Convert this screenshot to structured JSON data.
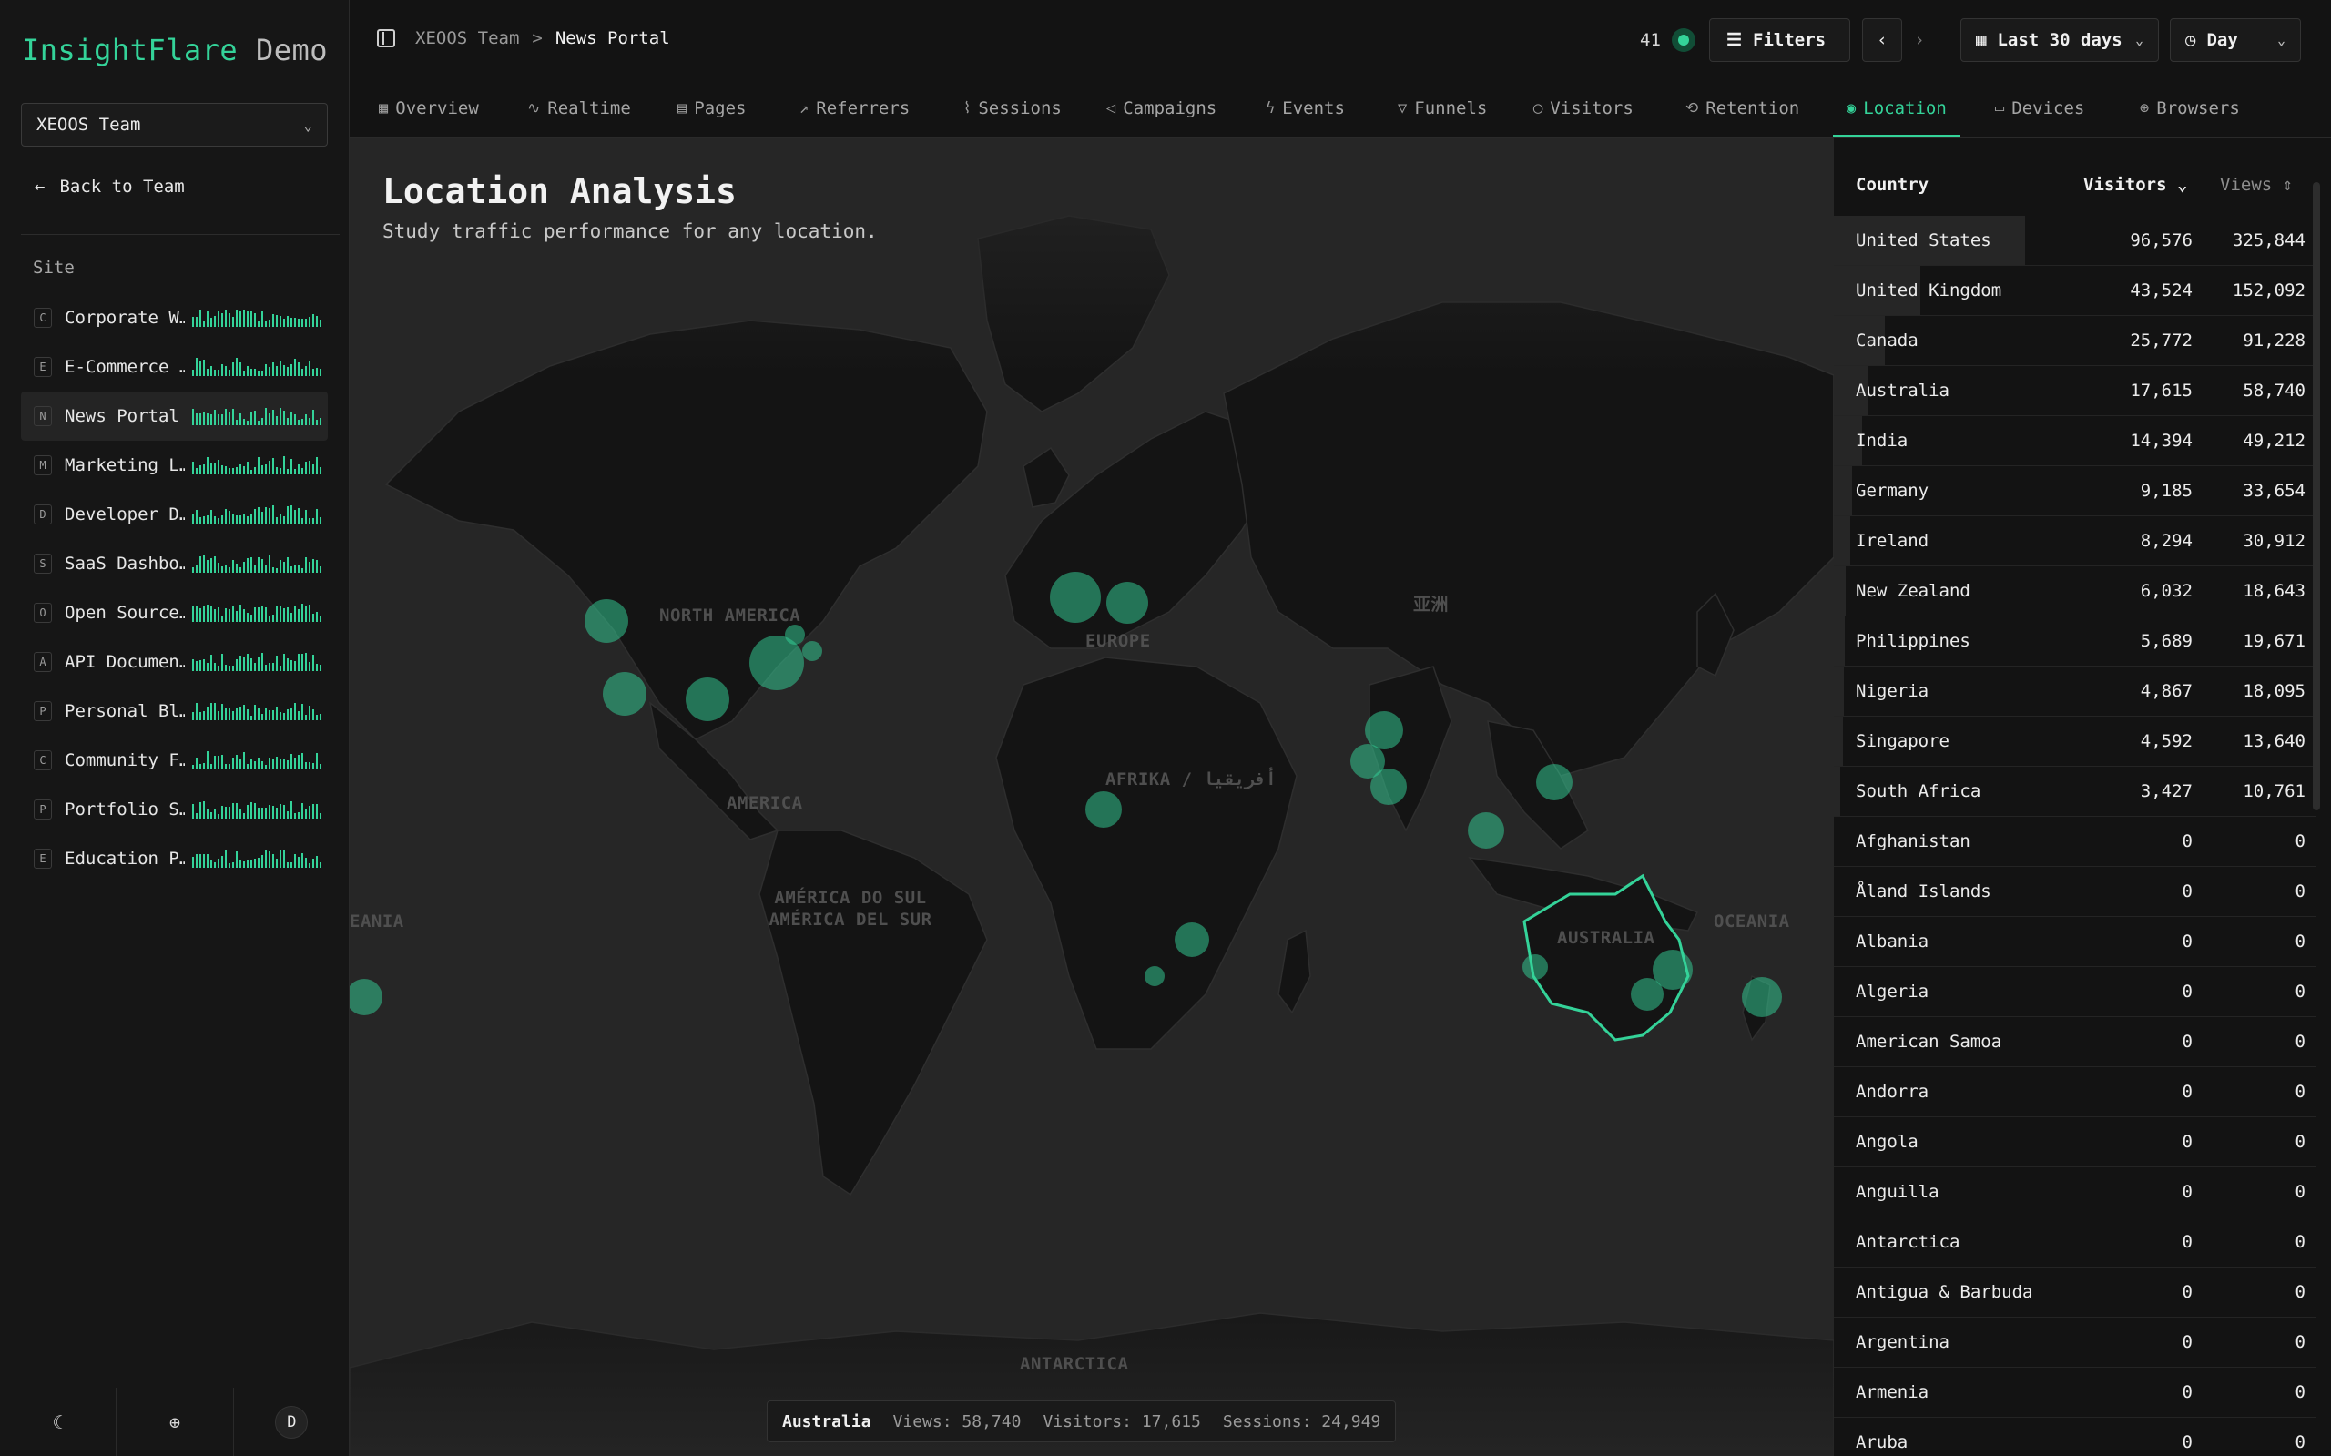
{
  "brand": {
    "name": "InsightFlare",
    "suffix": "Demo"
  },
  "team_select": {
    "value": "XEOOS Team"
  },
  "back_label": "Back to Team",
  "site_section_label": "Site",
  "sites": [
    {
      "badge": "C",
      "name": "Corporate W…"
    },
    {
      "badge": "E",
      "name": "E-Commerce …"
    },
    {
      "badge": "N",
      "name": "News Portal"
    },
    {
      "badge": "M",
      "name": "Marketing L…"
    },
    {
      "badge": "D",
      "name": "Developer D…"
    },
    {
      "badge": "S",
      "name": "SaaS Dashbo…"
    },
    {
      "badge": "O",
      "name": "Open Source…"
    },
    {
      "badge": "A",
      "name": "API Documen…"
    },
    {
      "badge": "P",
      "name": "Personal Bl…"
    },
    {
      "badge": "C",
      "name": "Community F…"
    },
    {
      "badge": "P",
      "name": "Portfolio S…"
    },
    {
      "badge": "E",
      "name": "Education P…"
    }
  ],
  "active_site_index": 2,
  "footer": {
    "avatar_initial": "D"
  },
  "breadcrumb": {
    "team": "XEOOS Team",
    "separator": ">",
    "site": "News Portal"
  },
  "live_count": "41",
  "toolbar": {
    "filters_label": "Filters",
    "range_label": "Last 30 days",
    "granularity_label": "Day"
  },
  "tabs": [
    {
      "label": "Overview",
      "icon": "grid-icon"
    },
    {
      "label": "Realtime",
      "icon": "pulse-icon"
    },
    {
      "label": "Pages",
      "icon": "page-icon"
    },
    {
      "label": "Referrers",
      "icon": "referrer-icon"
    },
    {
      "label": "Sessions",
      "icon": "activity-icon"
    },
    {
      "label": "Campaigns",
      "icon": "megaphone-icon"
    },
    {
      "label": "Events",
      "icon": "bolt-icon"
    },
    {
      "label": "Funnels",
      "icon": "funnel-icon"
    },
    {
      "label": "Visitors",
      "icon": "user-icon"
    },
    {
      "label": "Retention",
      "icon": "repeat-icon"
    },
    {
      "label": "Location",
      "icon": "pin-icon"
    },
    {
      "label": "Devices",
      "icon": "monitor-icon"
    },
    {
      "label": "Browsers",
      "icon": "globe-icon"
    }
  ],
  "active_tab": "Location",
  "page": {
    "title": "Location Analysis",
    "subtitle": "Study traffic performance for any location."
  },
  "map_labels": [
    "NORTH AMERICA",
    "EUROPE",
    "亚洲",
    "AFRIKA / أفريقيا",
    "AMERICA",
    "AMÉRICA DO SUL AMÉRICA DEL SUR",
    "AUSTRALIA",
    "OCEANIA",
    "EANIA",
    "ANTARCTICA"
  ],
  "map_colors": {
    "bubble": "#34d399",
    "highlight": "#34d399"
  },
  "selected": {
    "country": "Australia",
    "views_label": "Views:",
    "views": "58,740",
    "visitors_label": "Visitors:",
    "visitors": "17,615",
    "sessions_label": "Sessions:",
    "sessions": "24,949"
  },
  "table": {
    "headers": {
      "country": "Country",
      "visitors": "Visitors",
      "views": "Views"
    },
    "sort": {
      "column": "Visitors",
      "direction": "desc"
    },
    "rows": [
      {
        "country": "United States",
        "visitors": "96,576",
        "views": "325,844"
      },
      {
        "country": "United Kingdom",
        "visitors": "43,524",
        "views": "152,092"
      },
      {
        "country": "Canada",
        "visitors": "25,772",
        "views": "91,228"
      },
      {
        "country": "Australia",
        "visitors": "17,615",
        "views": "58,740"
      },
      {
        "country": "India",
        "visitors": "14,394",
        "views": "49,212"
      },
      {
        "country": "Germany",
        "visitors": "9,185",
        "views": "33,654"
      },
      {
        "country": "Ireland",
        "visitors": "8,294",
        "views": "30,912"
      },
      {
        "country": "New Zealand",
        "visitors": "6,032",
        "views": "18,643"
      },
      {
        "country": "Philippines",
        "visitors": "5,689",
        "views": "19,671"
      },
      {
        "country": "Nigeria",
        "visitors": "4,867",
        "views": "18,095"
      },
      {
        "country": "Singapore",
        "visitors": "4,592",
        "views": "13,640"
      },
      {
        "country": "South Africa",
        "visitors": "3,427",
        "views": "10,761"
      },
      {
        "country": "Afghanistan",
        "visitors": "0",
        "views": "0"
      },
      {
        "country": "Åland Islands",
        "visitors": "0",
        "views": "0"
      },
      {
        "country": "Albania",
        "visitors": "0",
        "views": "0"
      },
      {
        "country": "Algeria",
        "visitors": "0",
        "views": "0"
      },
      {
        "country": "American Samoa",
        "visitors": "0",
        "views": "0"
      },
      {
        "country": "Andorra",
        "visitors": "0",
        "views": "0"
      },
      {
        "country": "Angola",
        "visitors": "0",
        "views": "0"
      },
      {
        "country": "Anguilla",
        "visitors": "0",
        "views": "0"
      },
      {
        "country": "Antarctica",
        "visitors": "0",
        "views": "0"
      },
      {
        "country": "Antigua & Barbuda",
        "visitors": "0",
        "views": "0"
      },
      {
        "country": "Argentina",
        "visitors": "0",
        "views": "0"
      },
      {
        "country": "Armenia",
        "visitors": "0",
        "views": "0"
      },
      {
        "country": "Aruba",
        "visitors": "0",
        "views": "0"
      }
    ]
  }
}
